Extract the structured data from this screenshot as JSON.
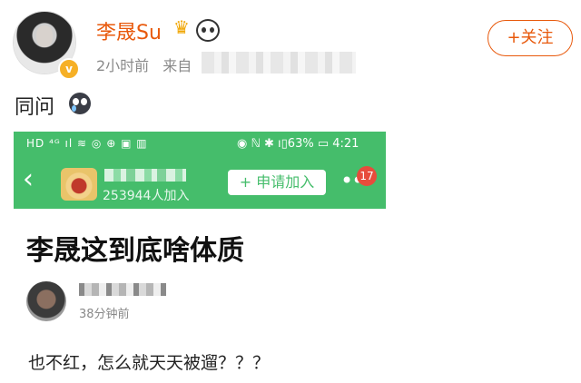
{
  "post": {
    "username": "李晟Su",
    "time": "2小时前",
    "source_prefix": "来自",
    "follow_label": "+关注",
    "text": "同问"
  },
  "icons": {
    "crown": "crown-icon",
    "panda": "panda-icon",
    "cry": "cry-emoji-icon",
    "verified": "verified-badge-icon"
  },
  "embedded": {
    "status_left": "HD ⁴ᴳ ıl ≋ ◎ ⊕ ▣ ▥",
    "status_right": "◉ ℕ ✱ ı▯63% ▭ 4:21",
    "member_count": "253944人加入",
    "join_label": "+ 申请加入",
    "notif_count": "17",
    "thread_title": "李晟这到底啥体质",
    "post_time": "38分钟前",
    "thread_body": "也不红，怎么就天天被遛？？？"
  },
  "colors": {
    "accent_orange": "#e8590c",
    "tieba_green": "#45bd6b",
    "badge_red": "#e74c3c"
  }
}
